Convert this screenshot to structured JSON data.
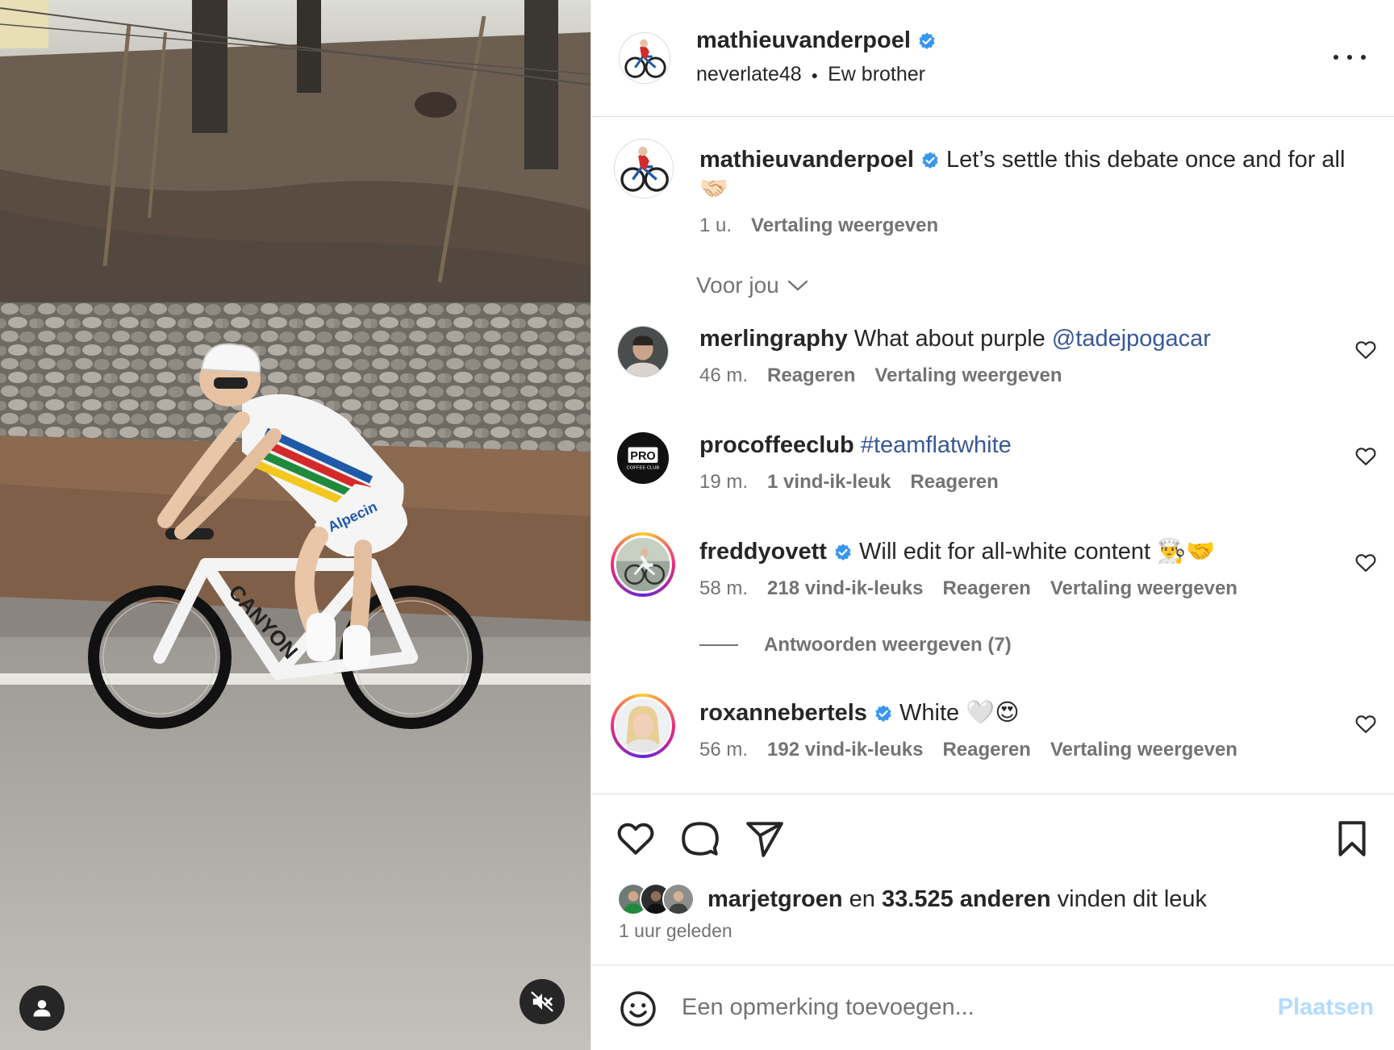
{
  "post": {
    "author": "mathieuvanderpoel",
    "author_verified": true,
    "audio_user": "neverlate48",
    "audio_title": "Ew brother",
    "more_icon": "more-horizontal-icon"
  },
  "caption": {
    "username": "mathieuvanderpoel",
    "text": "Let’s settle this debate once and for all",
    "emoji": "🤝🏻",
    "age": "1 u.",
    "translate": "Vertaling weergeven"
  },
  "sort": {
    "label": "Voor jou",
    "icon": "chevron-down-icon"
  },
  "comments": [
    {
      "username": "merlingraphy",
      "verified": false,
      "text": "What about purple ",
      "mention": "@tadejpogacar",
      "age": "46 m.",
      "likes": "",
      "reply": "Reageren",
      "translate": "Vertaling weergeven"
    },
    {
      "username": "procoffeeclub",
      "verified": false,
      "text": "",
      "mention": "#teamflatwhite",
      "age": "19 m.",
      "likes": "1 vind-ik-leuk",
      "reply": "Reageren",
      "translate": ""
    },
    {
      "username": "freddyovett",
      "verified": true,
      "text": "Will edit for all-white content 👨‍🍳🤝",
      "mention": "",
      "age": "58 m.",
      "likes": "218 vind-ik-leuks",
      "reply": "Reageren",
      "translate": "Vertaling weergeven"
    },
    {
      "username": "roxannebertels",
      "verified": true,
      "text": "White 🤍😍",
      "mention": "",
      "age": "56 m.",
      "likes": "192 vind-ik-leuks",
      "reply": "Reageren",
      "translate": "Vertaling weergeven"
    }
  ],
  "replies_label": "Antwoorden weergeven (7)",
  "procoffee_logo": {
    "line1": "PRO",
    "line2": "COFFEE CLUB"
  },
  "likes": {
    "first_liker": "marjetgroen",
    "connector": "en",
    "others": "33.525 anderen",
    "suffix": "vinden dit leuk",
    "time": "1 uur geleden"
  },
  "composer": {
    "placeholder": "Een opmerking toevoegen...",
    "post_label": "Plaatsen",
    "emoji_icon": "smiley-icon"
  },
  "colors": {
    "verified_blue": "#3897f0",
    "link_blue": "#385898",
    "muted_text": "#737373",
    "post_disabled": "#b3dbff",
    "jersey_blue": "#1e5aa8",
    "jersey_red": "#d42a2a",
    "jersey_green": "#1f8a3b",
    "jersey_yellow": "#f2c81f"
  },
  "media": {
    "tag_icon": "user-tag-icon",
    "mute_icon": "speaker-muted-icon",
    "bike_text": "CANYON",
    "sponsor_text": "Alpecin"
  }
}
